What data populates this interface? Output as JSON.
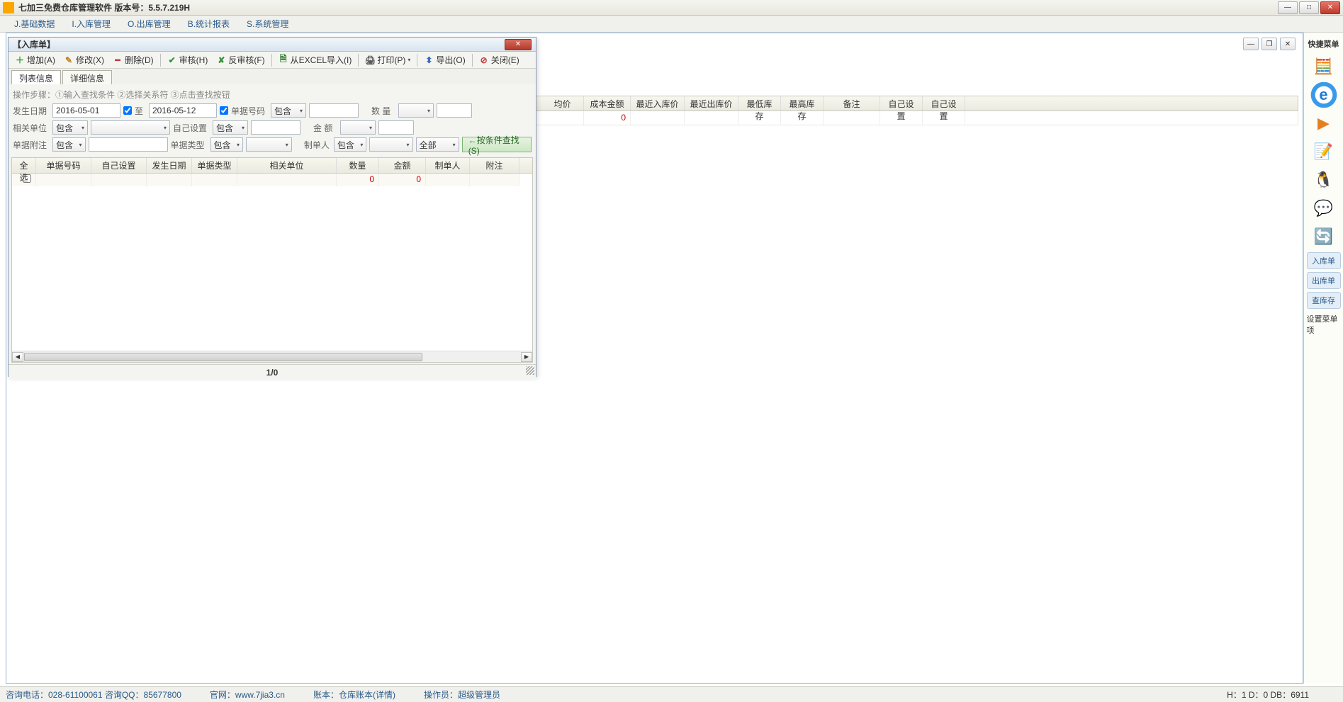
{
  "titlebar": {
    "title": "七加三免费仓库管理软件 版本号：5.5.7.219H"
  },
  "menubar": {
    "items": [
      "J.基础数据",
      "I.入库管理",
      "O.出库管理",
      "B.统计报表",
      "S.系统管理"
    ]
  },
  "background_grid": {
    "columns": [
      "均价",
      "成本金额",
      "最近入库价",
      "最近出库价",
      "最低库存",
      "最高库存",
      "备注",
      "自己设置",
      "自己设置"
    ],
    "totals_zero": "0"
  },
  "inner": {
    "title": "【入库单】",
    "toolbar": {
      "add": "增加(A)",
      "edit": "修改(X)",
      "del": "删除(D)",
      "audit": "审核(H)",
      "unaudit": "反审核(F)",
      "excel": "从EXCEL导入(I)",
      "print": "打印(P)",
      "export": "导出(O)",
      "close": "关闭(E)"
    },
    "tabs": {
      "list": "列表信息",
      "detail": "详细信息"
    },
    "filter": {
      "hint": "操作步骤：①输入查找条件 ②选择关系符 ③点击查找按钮",
      "labels": {
        "date": "发生日期",
        "to": "至",
        "docno": "单据号码",
        "qty": "数 量",
        "partner": "相关单位",
        "selfset": "自己设置",
        "amount": "金 额",
        "docnote": "单据附注",
        "doctype": "单据类型",
        "creator": "制单人"
      },
      "values": {
        "date_from": "2016-05-01",
        "date_to": "2016-05-12",
        "contain": "包含",
        "all": "全部"
      },
      "search_btn": "←按条件查找(S)"
    },
    "grid": {
      "columns": [
        "全选",
        "单据号码",
        "自己设置",
        "发生日期",
        "单据类型",
        "相关单位",
        "数量",
        "金额",
        "制单人",
        "附注"
      ],
      "total_qty": "0",
      "total_amount": "0"
    },
    "pager": "1/0"
  },
  "quickpanel": {
    "title": "快捷菜单",
    "icons": [
      {
        "name": "calculator-icon",
        "glyph": "🧮"
      },
      {
        "name": "ie-icon",
        "glyph": "e"
      },
      {
        "name": "media-icon",
        "glyph": "▶"
      },
      {
        "name": "notepad-icon",
        "glyph": "📝"
      },
      {
        "name": "qq-icon",
        "glyph": "🐧"
      },
      {
        "name": "wechat-icon",
        "glyph": "💬"
      },
      {
        "name": "sync-icon",
        "glyph": "🔄"
      }
    ],
    "text_buttons": [
      {
        "label": "入库单",
        "selected": true
      },
      {
        "label": "出库单",
        "selected": false
      },
      {
        "label": "查库存",
        "selected": false
      }
    ],
    "settings": "设置菜单项"
  },
  "statusbar": {
    "tel": "咨询电话：028-61100061 咨询QQ：85677800",
    "site": "官网：www.7jia3.cn",
    "account": "账本：仓库账本(详情)",
    "operator": "操作员：超级管理员",
    "db": "H：1 D：0 DB：6911"
  }
}
